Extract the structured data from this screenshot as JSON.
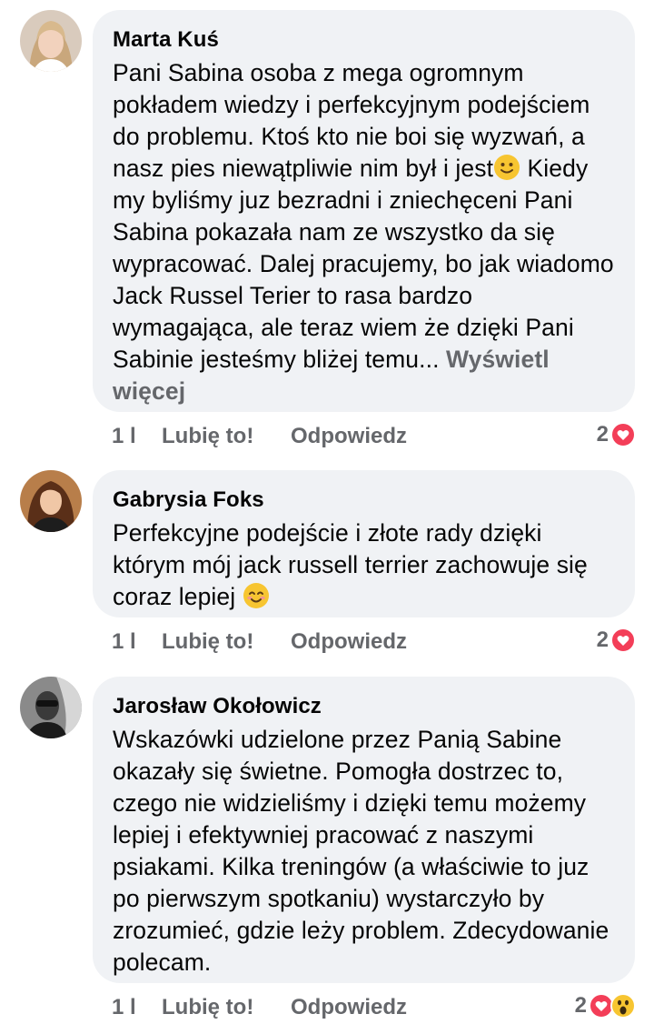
{
  "comments": [
    {
      "author": "Marta Kuś",
      "text_before_emoji": "Pani Sabina osoba z mega ogromnym pokładem wiedzy i perfekcyjnym podejściem do problemu. Ktoś kto nie boi się wyzwań, a nasz pies niewątpliwie nim był i jest",
      "emoji": "slightly-smiling-face",
      "text_after_emoji": "  Kiedy my byliśmy juz bezradni i zniechęceni Pani Sabina pokazała nam ze wszystko da się wypracować.  Dalej pracujemy, bo jak wiadomo Jack Russel Terier to rasa bardzo wymagająca, ale teraz wiem że dzięki Pani Sabinie jesteśmy bliżej temu...",
      "see_more": "Wyświetl więcej",
      "time": "1 l",
      "like_label": "Lubię to!",
      "reply_label": "Odpowiedz",
      "reaction_count": "2",
      "reaction_icons": [
        "love-reaction-icon"
      ]
    },
    {
      "author": "Gabrysia Foks",
      "text_before_emoji": "Perfekcyjne podejście i złote rady dzięki którym mój jack russell terrier zachowuje się coraz lepiej ",
      "emoji": "smiling-face-with-smiling-eyes",
      "time": "1 l",
      "like_label": "Lubię to!",
      "reply_label": "Odpowiedz",
      "reaction_count": "2",
      "reaction_icons": [
        "love-reaction-icon"
      ]
    },
    {
      "author": "Jarosław Okołowicz",
      "text_before_emoji": "Wskazówki udzielone przez Panią Sabine okazały się świetne. Pomogła dostrzec to, czego nie widzieliśmy i dzięki temu możemy lepiej i efektywniej pracować z naszymi psiakami. Kilka treningów (a właściwie to juz po pierwszym spotkaniu) wystarczyło by zrozumieć, gdzie leży problem. Zdecydowanie polecam.",
      "time": "1 l",
      "like_label": "Lubię to!",
      "reply_label": "Odpowiedz",
      "reaction_count": "2",
      "reaction_icons": [
        "love-reaction-icon",
        "wow-reaction-icon"
      ]
    }
  ],
  "colors": {
    "bubble": "#f0f2f5",
    "secondary_text": "#65676b",
    "love": "#f33e58",
    "emoji_yellow": "#f7c531"
  }
}
